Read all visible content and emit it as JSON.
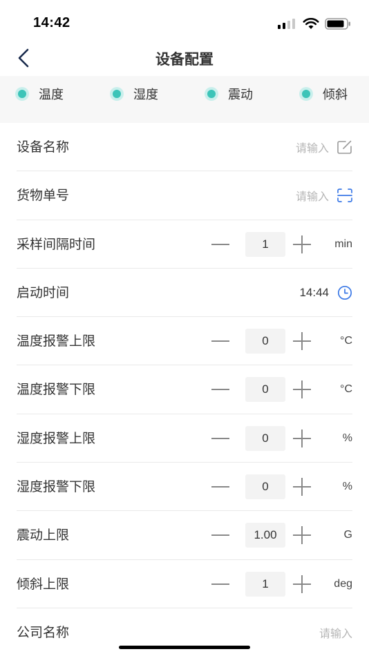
{
  "status_bar": {
    "time": "14:42"
  },
  "nav": {
    "title": "设备配置"
  },
  "sensors": [
    {
      "label": "温度",
      "checked": true
    },
    {
      "label": "湿度",
      "checked": true
    },
    {
      "label": "震动",
      "checked": true
    },
    {
      "label": "倾斜",
      "checked": true
    }
  ],
  "form": {
    "device_name": {
      "label": "设备名称",
      "placeholder": "请输入"
    },
    "cargo_no": {
      "label": "货物单号",
      "placeholder": "请输入"
    },
    "sample_interval": {
      "label": "采样间隔时间",
      "value": "1",
      "unit": "min"
    },
    "start_time": {
      "label": "启动时间",
      "value": "14:44"
    },
    "temp_upper": {
      "label": "温度报警上限",
      "value": "0",
      "unit": "°C"
    },
    "temp_lower": {
      "label": "温度报警下限",
      "value": "0",
      "unit": "°C"
    },
    "hum_upper": {
      "label": "湿度报警上限",
      "value": "0",
      "unit": "%"
    },
    "hum_lower": {
      "label": "湿度报警下限",
      "value": "0",
      "unit": "%"
    },
    "vib_upper": {
      "label": "震动上限",
      "value": "1.00",
      "unit": "G"
    },
    "tilt_upper": {
      "label": "倾斜上限",
      "value": "1",
      "unit": "deg"
    },
    "company": {
      "label": "公司名称",
      "placeholder": "请输入"
    }
  },
  "colors": {
    "accent_teal": "#3cc4b8",
    "accent_blue": "#3a78e6"
  }
}
